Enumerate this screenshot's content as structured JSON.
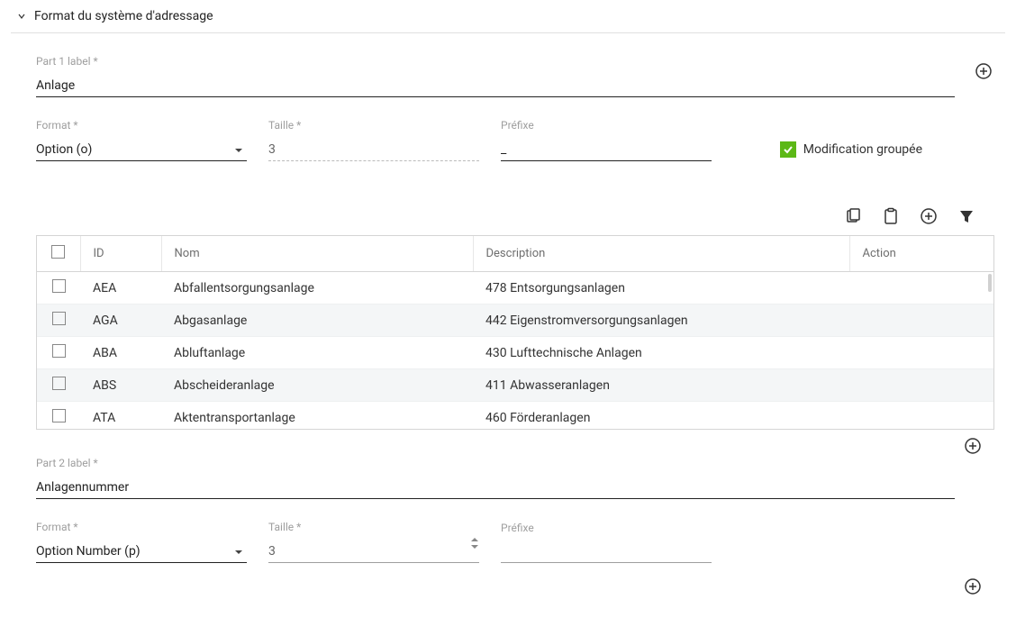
{
  "section_title": "Format du système d'adressage",
  "part1": {
    "label_caption": "Part 1 label *",
    "label_value": "Anlage",
    "format_caption": "Format *",
    "format_value": "Option (o)",
    "taille_caption": "Taille *",
    "taille_value": "3",
    "prefixe_caption": "Préfixe",
    "prefixe_value": "_",
    "group_mod_label": "Modification groupée"
  },
  "table": {
    "headers": {
      "id": "ID",
      "nom": "Nom",
      "description": "Description",
      "action": "Action"
    },
    "rows": [
      {
        "id": "AEA",
        "nom": "Abfallentsorgungsanlage",
        "description": "478 Entsorgungsanlagen"
      },
      {
        "id": "AGA",
        "nom": "Abgasanlage",
        "description": "442 Eigenstromversorgungsanlagen"
      },
      {
        "id": "ABA",
        "nom": "Abluftanlage",
        "description": "430 Lufttechnische Anlagen"
      },
      {
        "id": "ABS",
        "nom": "Abscheideranlage",
        "description": "411 Abwasseranlagen"
      },
      {
        "id": "ATA",
        "nom": "Aktentransportanlage",
        "description": "460 Förderanlagen"
      }
    ]
  },
  "part2": {
    "label_caption": "Part 2 label *",
    "label_value": "Anlagennummer",
    "format_caption": "Format *",
    "format_value": "Option Number (p)",
    "taille_caption": "Taille *",
    "taille_value": "3",
    "prefixe_caption": "Préfixe",
    "prefixe_value": ""
  }
}
